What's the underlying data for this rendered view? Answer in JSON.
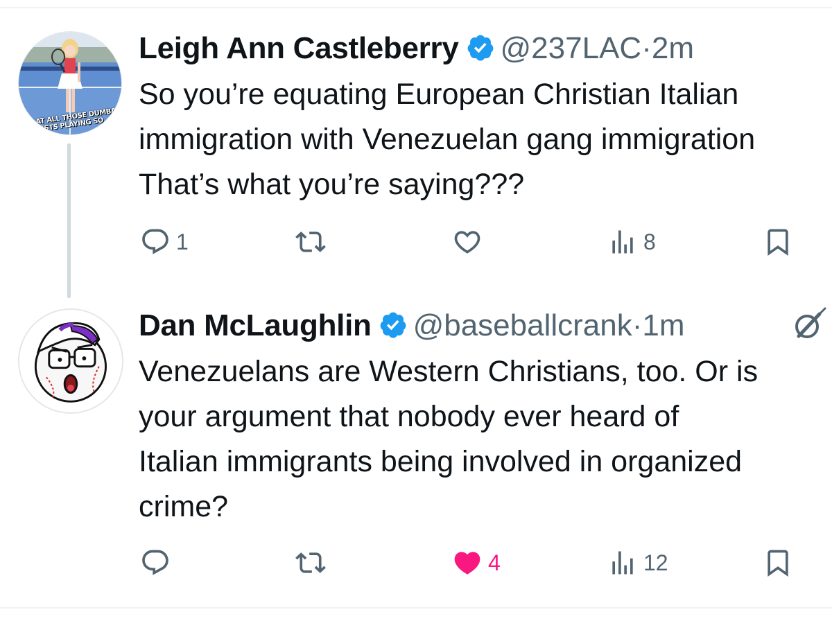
{
  "tweets": [
    {
      "name": "Leigh Ann Castleberry",
      "handle": "@237LAC",
      "separator": "·",
      "time": "2m",
      "avatar_caption": "OK AT ALL THOSE DUMBA LISTS PLAYING SO",
      "text": "So you’re equating European Christian Italian\nimmigration with Venezuelan gang immigration\nThat’s what you’re saying???",
      "reply_count": "1",
      "retweet_count": "",
      "like_count": "",
      "view_count": "8",
      "liked": false
    },
    {
      "name": "Dan McLaughlin",
      "handle": "@baseballcrank",
      "separator": "·",
      "time": "1m",
      "text": "Venezuelans are Western Christians, too. Or is\nyour argument that nobody ever heard of\nItalian immigrants being involved in organized\ncrime?",
      "reply_count": "",
      "retweet_count": "",
      "like_count": "4",
      "view_count": "12",
      "liked": true
    }
  ],
  "icons": {
    "verified": "verified-badge-icon",
    "reply": "reply-icon",
    "retweet": "retweet-icon",
    "like": "heart-icon",
    "views": "views-icon",
    "bookmark": "bookmark-icon",
    "edit": "edited-icon"
  },
  "colors": {
    "verified": "#1d9bf0",
    "muted": "#536471",
    "like_active": "#f91880",
    "thread_line": "#cfd9de"
  }
}
